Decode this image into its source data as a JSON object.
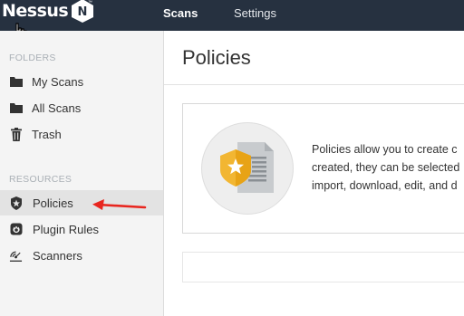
{
  "app": {
    "logo_text": "Nessus",
    "logo_badge": "N",
    "logo_mark": "™",
    "brand_accent": "#263140"
  },
  "nav": {
    "tabs": [
      {
        "label": "Scans",
        "active": true
      },
      {
        "label": "Settings",
        "active": false
      }
    ]
  },
  "sidebar": {
    "folders_label": "FOLDERS",
    "folders": [
      {
        "label": "My Scans",
        "icon": "folder-icon"
      },
      {
        "label": "All Scans",
        "icon": "folder-icon"
      },
      {
        "label": "Trash",
        "icon": "trash-icon"
      }
    ],
    "resources_label": "RESOURCES",
    "resources": [
      {
        "label": "Policies",
        "icon": "policy-shield-icon",
        "active": true
      },
      {
        "label": "Plugin Rules",
        "icon": "plugin-rules-icon",
        "active": false
      },
      {
        "label": "Scanners",
        "icon": "scanner-icon",
        "active": false
      }
    ]
  },
  "main": {
    "title": "Policies",
    "info_lines": [
      "Policies allow you to create c",
      "created, they can be selected",
      "import, download, edit, and d"
    ]
  },
  "annotation": {
    "arrow_color": "#e8261f"
  }
}
